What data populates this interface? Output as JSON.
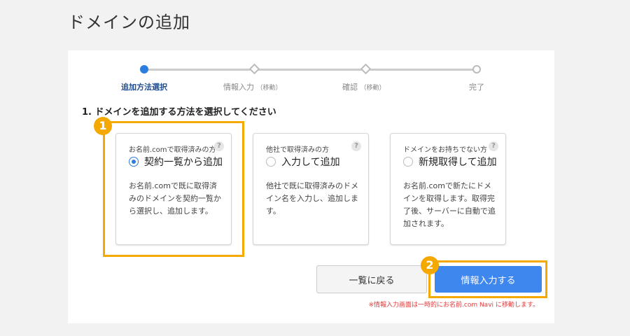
{
  "page": {
    "title": "ドメインの追加"
  },
  "stepper": {
    "steps": [
      {
        "label": "追加方法選択",
        "sub": "",
        "state": "active"
      },
      {
        "label": "情報入力",
        "sub": "（移動）",
        "state": "pending"
      },
      {
        "label": "確認",
        "sub": "（移動）",
        "state": "pending"
      },
      {
        "label": "完了",
        "sub": "",
        "state": "pending"
      }
    ]
  },
  "section": {
    "title": "1. ドメインを追加する方法を選択してください"
  },
  "cards": [
    {
      "subtitle": "お名前.comで取得済みの方",
      "option": "契約一覧から追加",
      "selected": true,
      "description": "お名前.comで既に取得済みのドメインを契約一覧から選択し、追加します。",
      "help": "?"
    },
    {
      "subtitle": "他社で取得済みの方",
      "option": "入力して追加",
      "selected": false,
      "description": "他社で既に取得済みのドメイン名を入力し、追加します。",
      "help": "?"
    },
    {
      "subtitle": "ドメインをお持ちでない方",
      "option": "新規取得して追加",
      "selected": false,
      "description": "お名前.comで新たにドメインを取得します。取得完了後、サーバーに自動で追加されます。",
      "help": "?"
    }
  ],
  "buttons": {
    "back": "一覧に戻る",
    "next": "情報入力する"
  },
  "note": "※情報入力画面は一時的にお名前.com Navi に移動します。",
  "badges": {
    "one": "1",
    "two": "2"
  },
  "colors": {
    "accent": "#2d7de0",
    "primary_button": "#3d87ee",
    "highlight": "#f5a800",
    "note_red": "#e03c3c"
  }
}
